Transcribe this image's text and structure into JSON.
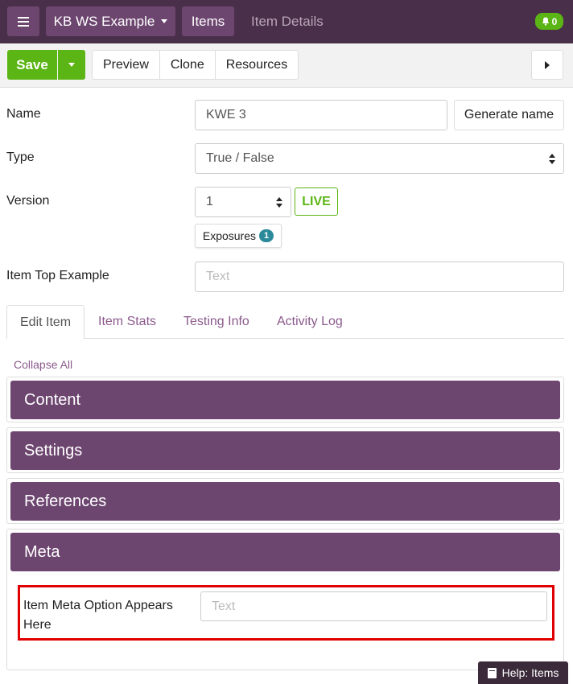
{
  "topbar": {
    "menu_icon": "hamburger-icon",
    "workspace_label": "KB WS Example",
    "items_label": "Items",
    "item_details_label": "Item Details",
    "notification_icon": "bell-icon",
    "notification_count": "0"
  },
  "toolbar": {
    "save_label": "Save",
    "preview_label": "Preview",
    "clone_label": "Clone",
    "resources_label": "Resources",
    "next_icon": "triangle-right-icon"
  },
  "form": {
    "name_label": "Name",
    "name_value": "KWE 3",
    "generate_name_label": "Generate name",
    "type_label": "Type",
    "type_value": "True / False",
    "version_label": "Version",
    "version_value": "1",
    "live_label": "LIVE",
    "exposures_label": "Exposures",
    "exposures_count": "1",
    "item_top_label": "Item Top Example",
    "item_top_placeholder": "Text"
  },
  "tabs": [
    {
      "label": "Edit Item",
      "active": true
    },
    {
      "label": "Item Stats",
      "active": false
    },
    {
      "label": "Testing Info",
      "active": false
    },
    {
      "label": "Activity Log",
      "active": false
    }
  ],
  "collapse_all_label": "Collapse All",
  "panels": {
    "content": "Content",
    "settings": "Settings",
    "references": "References",
    "meta": "Meta"
  },
  "meta": {
    "option_label": "Item Meta Option Appears Here",
    "option_placeholder": "Text"
  },
  "help": {
    "icon": "book-icon",
    "label": "Help: Items"
  },
  "colors": {
    "topbar": "#4a2f4a",
    "purple": "#6d4670",
    "green": "#5bb514",
    "highlight": "#e00000"
  }
}
